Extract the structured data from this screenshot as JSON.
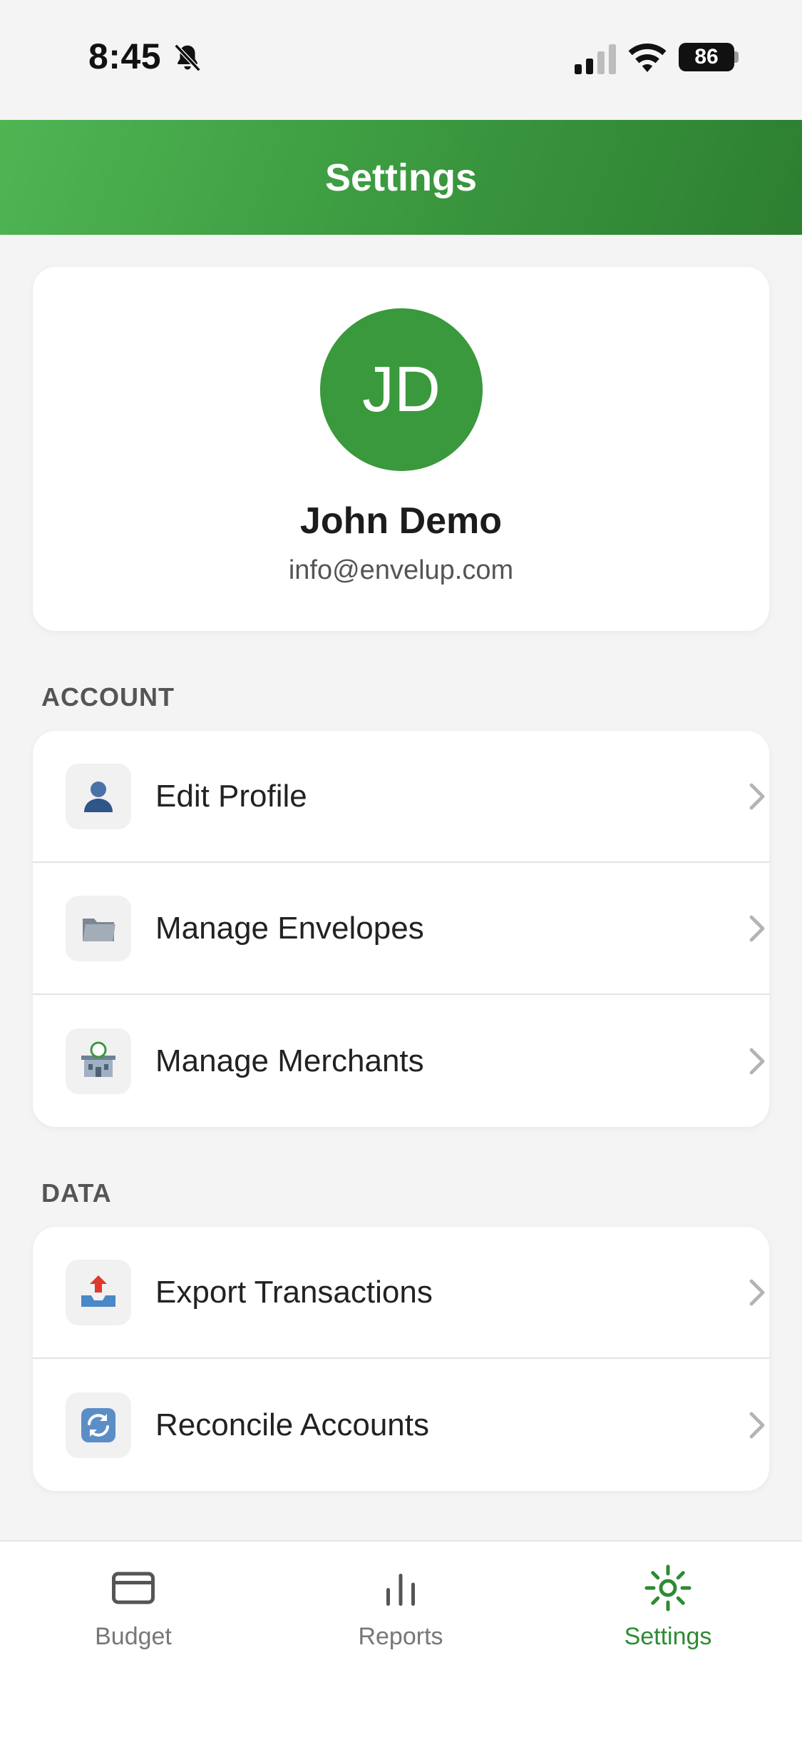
{
  "status_bar": {
    "time": "8:45",
    "battery": "86"
  },
  "header": {
    "title": "Settings"
  },
  "profile": {
    "initials": "JD",
    "name": "John Demo",
    "email": "info@envelup.com"
  },
  "sections": {
    "account": {
      "label": "ACCOUNT",
      "items": [
        {
          "label": "Edit Profile",
          "icon": "person-icon"
        },
        {
          "label": "Manage Envelopes",
          "icon": "folder-icon"
        },
        {
          "label": "Manage Merchants",
          "icon": "store-icon"
        }
      ]
    },
    "data": {
      "label": "DATA",
      "items": [
        {
          "label": "Export Transactions",
          "icon": "outbox-tray-icon"
        },
        {
          "label": "Reconcile Accounts",
          "icon": "refresh-icon"
        }
      ]
    }
  },
  "tabs": [
    {
      "label": "Budget",
      "icon": "card-icon",
      "active": false
    },
    {
      "label": "Reports",
      "icon": "bar-chart-icon",
      "active": false
    },
    {
      "label": "Settings",
      "icon": "gear-icon",
      "active": true
    }
  ],
  "colors": {
    "brand_green": "#3a983d",
    "active_tab": "#2e8b33",
    "background": "#f4f4f4"
  }
}
